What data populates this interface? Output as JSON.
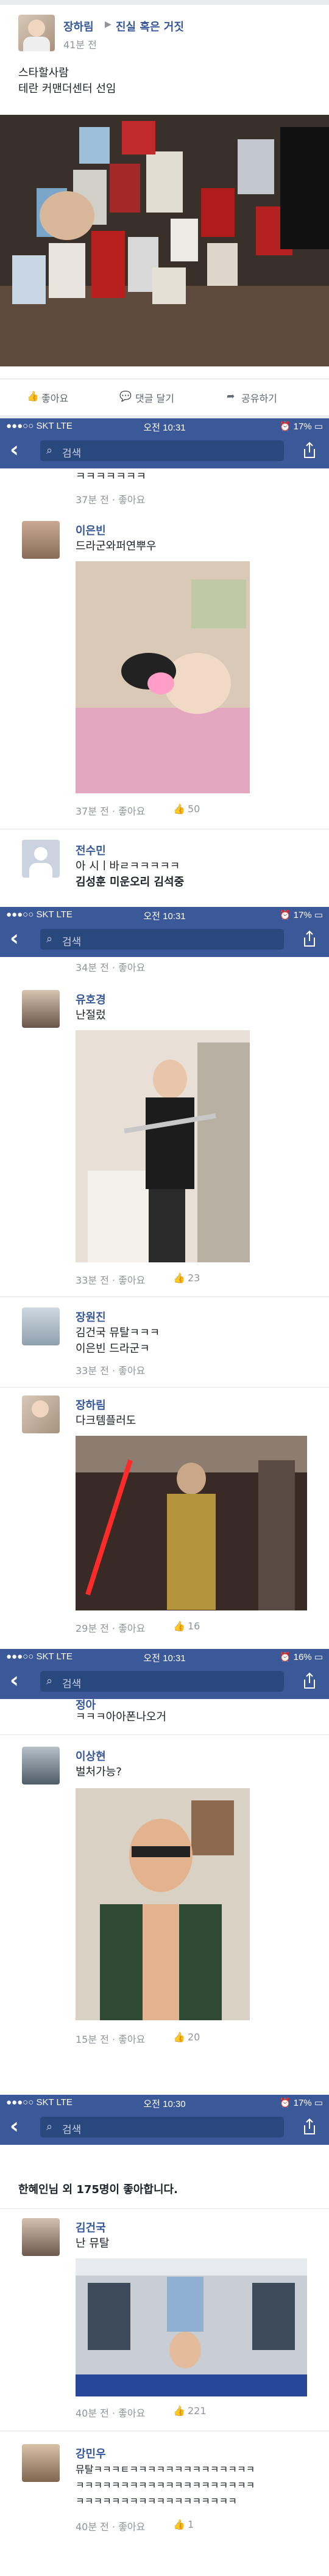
{
  "status": {
    "carrier": "●●●○○ SKT  LTE",
    "time1": "오전 10:31",
    "time2": "오전 10:31",
    "time3": "오전 10:31",
    "time4": "오전 10:30",
    "batt1": "⏰ 17% ▭",
    "batt2": "⏰ 17% ▭",
    "batt3": "⏰ 16% ▭",
    "batt4": "⏰ 17% ▭"
  },
  "search": {
    "placeholder": "검색",
    "back": "‹"
  },
  "post": {
    "author": "장하림",
    "arrow": "▶",
    "group": "진실 혹은 거짓",
    "time": "41분 전",
    "text1": "스타할사람",
    "text2": "테란 커맨더센터 선임",
    "like": "좋아요",
    "comment": "댓글 달기",
    "share": "공유하기"
  },
  "panel2": {
    "topcut": "ㅋㅋㅋㅋㅋㅋㅋ",
    "topmeta": "37분 전 · 좋아요",
    "c1": {
      "name": "이은빈",
      "text": "드라군와퍼연뿌우",
      "meta": "37분 전 · 좋아요",
      "likes": "50"
    },
    "c2": {
      "name": "전수민",
      "text1": "아 시ㅣ바ㄹㅋㅋㅋㅋㅋ",
      "text2": "김성훈 미운오리 김석중"
    }
  },
  "panel3": {
    "topmeta": "34분 전 · 좋아요",
    "c1": {
      "name": "유호경",
      "text": "난절렀",
      "meta": "33분 전 · 좋아요",
      "likes": "23"
    },
    "c2": {
      "name": "장원진",
      "text1": "김건국 뮤탈ㅋㅋㅋ",
      "text2": "이은빈 드라군ㅋ",
      "meta": "33분 전 · 좋아요"
    },
    "c3": {
      "name": "장하림",
      "text": "다크템플러도",
      "meta": "29분 전 · 좋아요",
      "likes": "16"
    }
  },
  "panel4": {
    "topname": "정아",
    "toptext": "ㅋㅋㅋ아아폰나오거",
    "c1": {
      "name": "이상현",
      "text": "벌처가능?",
      "meta": "15분 전 · 좋아요",
      "likes": "20"
    }
  },
  "panel5": {
    "likesummary": "한혜인님 외 175명이 좋아합니다.",
    "c1": {
      "name": "김건국",
      "text": "난 뮤탈",
      "meta": "40분 전 · 좋아요",
      "likes": "221"
    },
    "c2": {
      "name": "강민우",
      "text1": "뮤탈ㅋㅋㅋㅌㅋㅋㅋㅋㅋㅋㅋㅋㅋㅋㅋㅋㅋㅋ",
      "text2": "ㅋㅋㅋㅋㅋㅋㅋㅋㅋㅋㅋㅋㅋㅋㅋㅋㅋㅋㅋㅋ",
      "text3": "ㅋㅋㅋㅋㅋㅋㅋㅋㅋㅋㅋㅋㅋㅋㅋㅋㅋㅋ",
      "meta": "40분 전 · 좋아요",
      "likes": "1"
    }
  },
  "colors": {
    "fbblue": "#3b5998",
    "link": "#365899",
    "meta": "#90949c"
  }
}
